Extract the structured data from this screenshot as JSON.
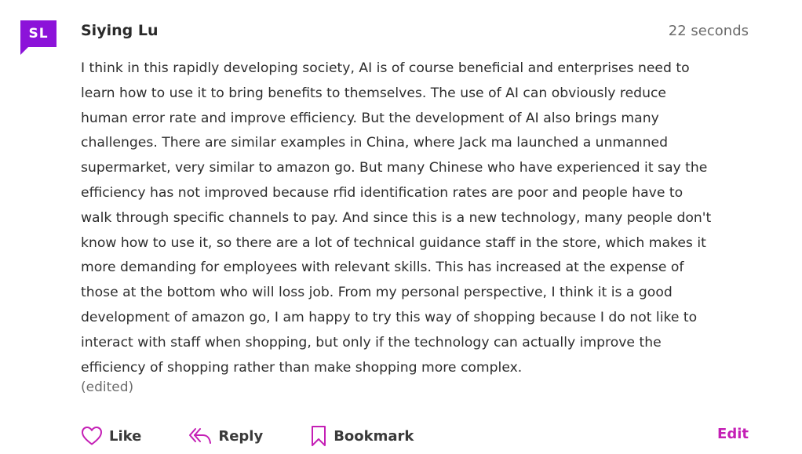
{
  "post": {
    "avatar_initials": "SL",
    "author": "Siying Lu",
    "timestamp": "22 seconds",
    "body": "I think in this rapidly developing society, AI is of course beneficial and enterprises need to\nlearn how to use it to bring benefits to themselves. The use of AI can obviously reduce\nhuman error rate and improve efficiency. But the development of AI also brings many\nchallenges. There are similar examples in China, where Jack ma launched a unmanned\nsupermarket, very similar to amazon go. But many Chinese who have experienced it say the\nefficiency has not improved because rfid identification rates are poor and people have to\nwalk through specific channels to pay. And since this is a new technology, many people don't\nknow how to use it, so there are a lot of technical guidance staff in the store, which makes it\nmore demanding for employees with relevant skills. This has increased at the expense of\nthose at the bottom who will loss job. From my personal perspective, I think it is a good\ndevelopment of amazon go, I am happy to try this way of shopping because I do not like to\ninteract with staff when shopping, but only if the technology can actually improve the\nefficiency of shopping rather than make shopping more complex.",
    "edited_label": "(edited)"
  },
  "actions": {
    "like_label": "Like",
    "like_icon": "heart-icon",
    "reply_label": "Reply",
    "reply_icon": "reply-icon",
    "bookmark_label": "Bookmark",
    "bookmark_icon": "bookmark-icon",
    "edit_label": "Edit"
  },
  "colors": {
    "avatar_bg": "#8c13d9",
    "accent": "#c41fb5",
    "icon": "#c41fb5"
  }
}
